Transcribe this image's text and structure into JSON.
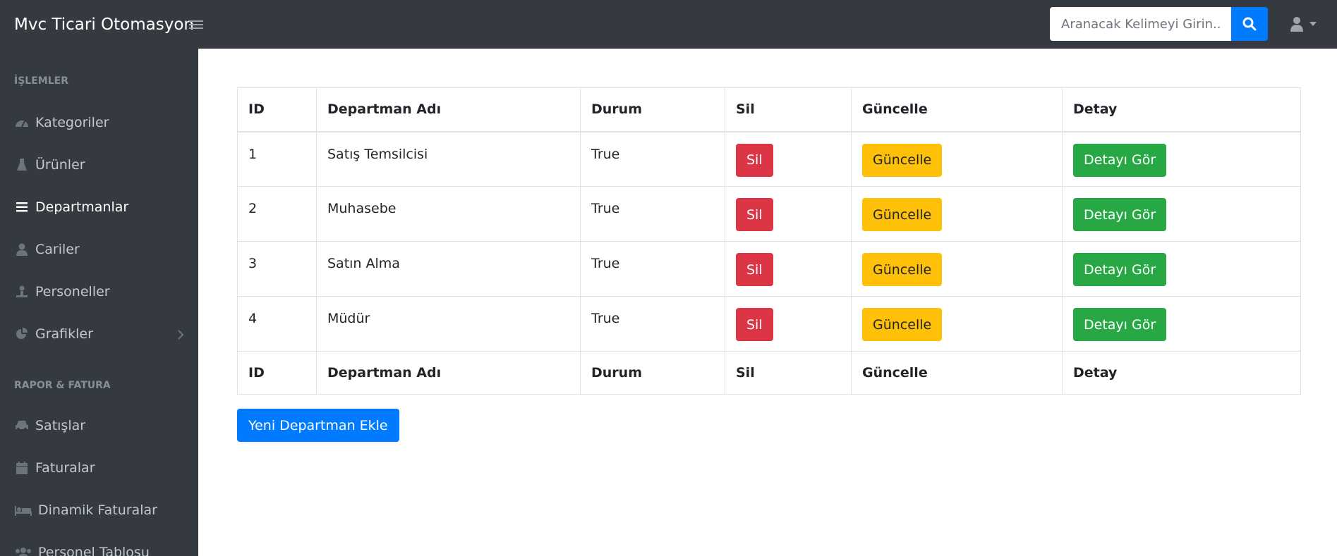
{
  "header": {
    "brand": "Mvc Ticari Otomasyon",
    "search_placeholder": "Aranacak Kelimeyi Girin..."
  },
  "sidebar": {
    "section1": "İŞLEMLER",
    "items1": [
      {
        "label": "Kategoriler",
        "icon": "dashboard-icon"
      },
      {
        "label": "Ürünler",
        "icon": "flask-icon"
      },
      {
        "label": "Departmanlar",
        "icon": "list-icon",
        "active": true
      },
      {
        "label": "Cariler",
        "icon": "user-icon"
      },
      {
        "label": "Personeller",
        "icon": "person-icon"
      },
      {
        "label": "Grafikler",
        "icon": "pie-chart-icon"
      }
    ],
    "section2": "RAPOR & FATURA",
    "items2": [
      {
        "label": "Satışlar",
        "icon": "car-icon"
      },
      {
        "label": "Faturalar",
        "icon": "calendar-icon"
      },
      {
        "label": "Dinamik Faturalar",
        "icon": "bed-icon"
      },
      {
        "label": "Personel Tablosu",
        "icon": "users-icon"
      }
    ]
  },
  "table": {
    "headers": [
      "ID",
      "Departman Adı",
      "Durum",
      "Sil",
      "Güncelle",
      "Detay"
    ],
    "rows": [
      {
        "id": "1",
        "name": "Satış Temsilcisi",
        "status": "True"
      },
      {
        "id": "2",
        "name": "Muhasebe",
        "status": "True"
      },
      {
        "id": "3",
        "name": "Satın Alma",
        "status": "True"
      },
      {
        "id": "4",
        "name": "Müdür",
        "status": "True"
      }
    ],
    "delete_label": "Sil",
    "update_label": "Güncelle",
    "detail_label": "Detayı Gör"
  },
  "add_button": "Yeni Departman Ekle",
  "colors": {
    "navbar": "#343a40",
    "danger": "#dc3545",
    "warning": "#ffc107",
    "success": "#28a745",
    "primary": "#007bff"
  }
}
